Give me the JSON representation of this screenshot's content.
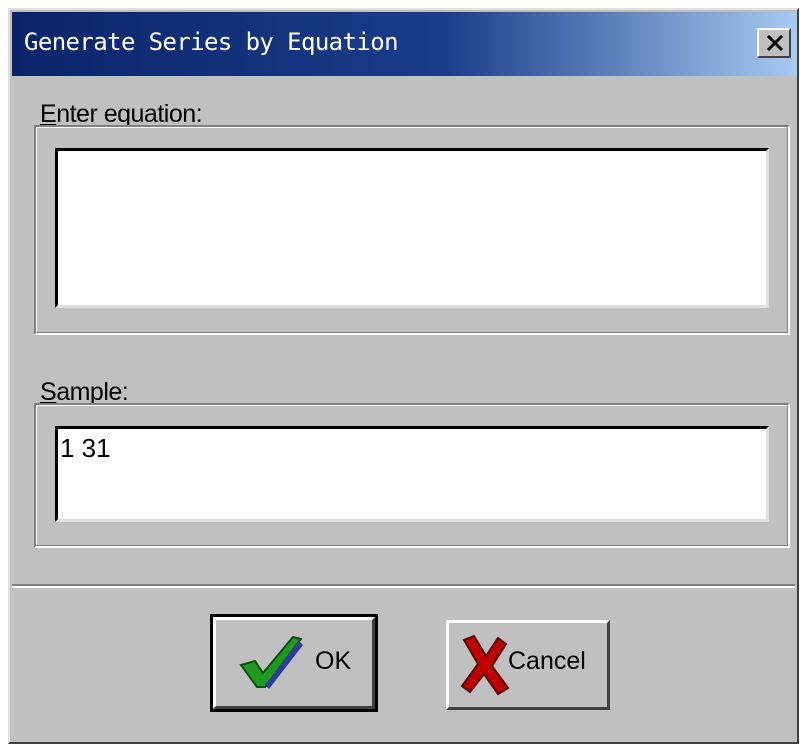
{
  "window": {
    "title": "Generate Series by Equation",
    "close_icon": "close-icon"
  },
  "equation": {
    "label_accel": "E",
    "label_rest": "nter equation:",
    "value": ""
  },
  "sample": {
    "label_accel": "S",
    "label_rest": "ample:",
    "value": "1 31"
  },
  "buttons": {
    "ok_label": "OK",
    "ok_icon": "checkmark-icon",
    "cancel_label": "Cancel",
    "cancel_icon": "red-x-icon"
  },
  "colors": {
    "titlebar_start": "#0a246a",
    "titlebar_end": "#a6caf0",
    "face": "#c0c0c0",
    "check_green": "#1f9a1f",
    "cancel_red": "#c00000"
  }
}
